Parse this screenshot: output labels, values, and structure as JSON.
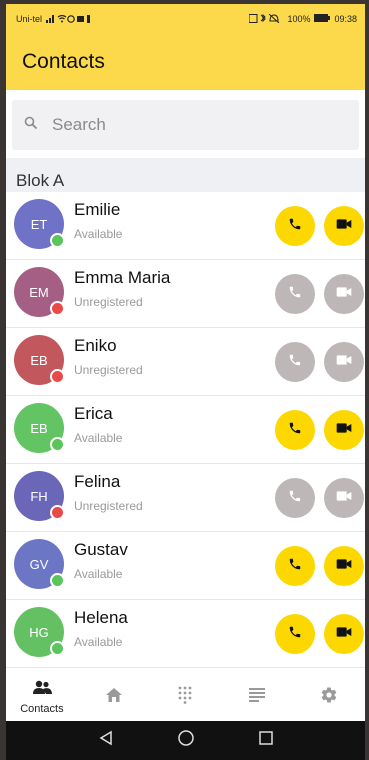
{
  "status_bar": {
    "carrier": "Uni-tel",
    "battery": "100%",
    "time": "09:38"
  },
  "header": {
    "title": "Contacts"
  },
  "search": {
    "placeholder": "Search"
  },
  "section": {
    "title": "Blok A"
  },
  "colors": {
    "accent": "#fcd94a",
    "button_active": "#fdd800",
    "button_disabled": "#bdb7b8",
    "status_available": "#5cc45c",
    "status_unregistered": "#e84a4a"
  },
  "contacts": [
    {
      "initials": "ET",
      "name": "Emilie",
      "status": "Available",
      "avatar_color": "#6f72c7",
      "online": true
    },
    {
      "initials": "EM",
      "name": "Emma Maria",
      "status": "Unregistered",
      "avatar_color": "#a55f85",
      "online": false
    },
    {
      "initials": "EB",
      "name": "Eniko",
      "status": "Unregistered",
      "avatar_color": "#c2575e",
      "online": false
    },
    {
      "initials": "EB",
      "name": "Erica",
      "status": "Available",
      "avatar_color": "#62c462",
      "online": true
    },
    {
      "initials": "FH",
      "name": "Felina",
      "status": "Unregistered",
      "avatar_color": "#6a67b8",
      "online": false
    },
    {
      "initials": "GV",
      "name": "Gustav",
      "status": "Available",
      "avatar_color": "#6b77c4",
      "online": true
    },
    {
      "initials": "HG",
      "name": "Helena",
      "status": "Available",
      "avatar_color": "#63c163",
      "online": true
    }
  ],
  "tabs": [
    {
      "label": "Contacts",
      "icon": "contacts-icon"
    },
    {
      "label": "",
      "icon": "home-icon"
    },
    {
      "label": "",
      "icon": "dialpad-icon"
    },
    {
      "label": "",
      "icon": "list-icon"
    },
    {
      "label": "",
      "icon": "gear-icon"
    }
  ]
}
